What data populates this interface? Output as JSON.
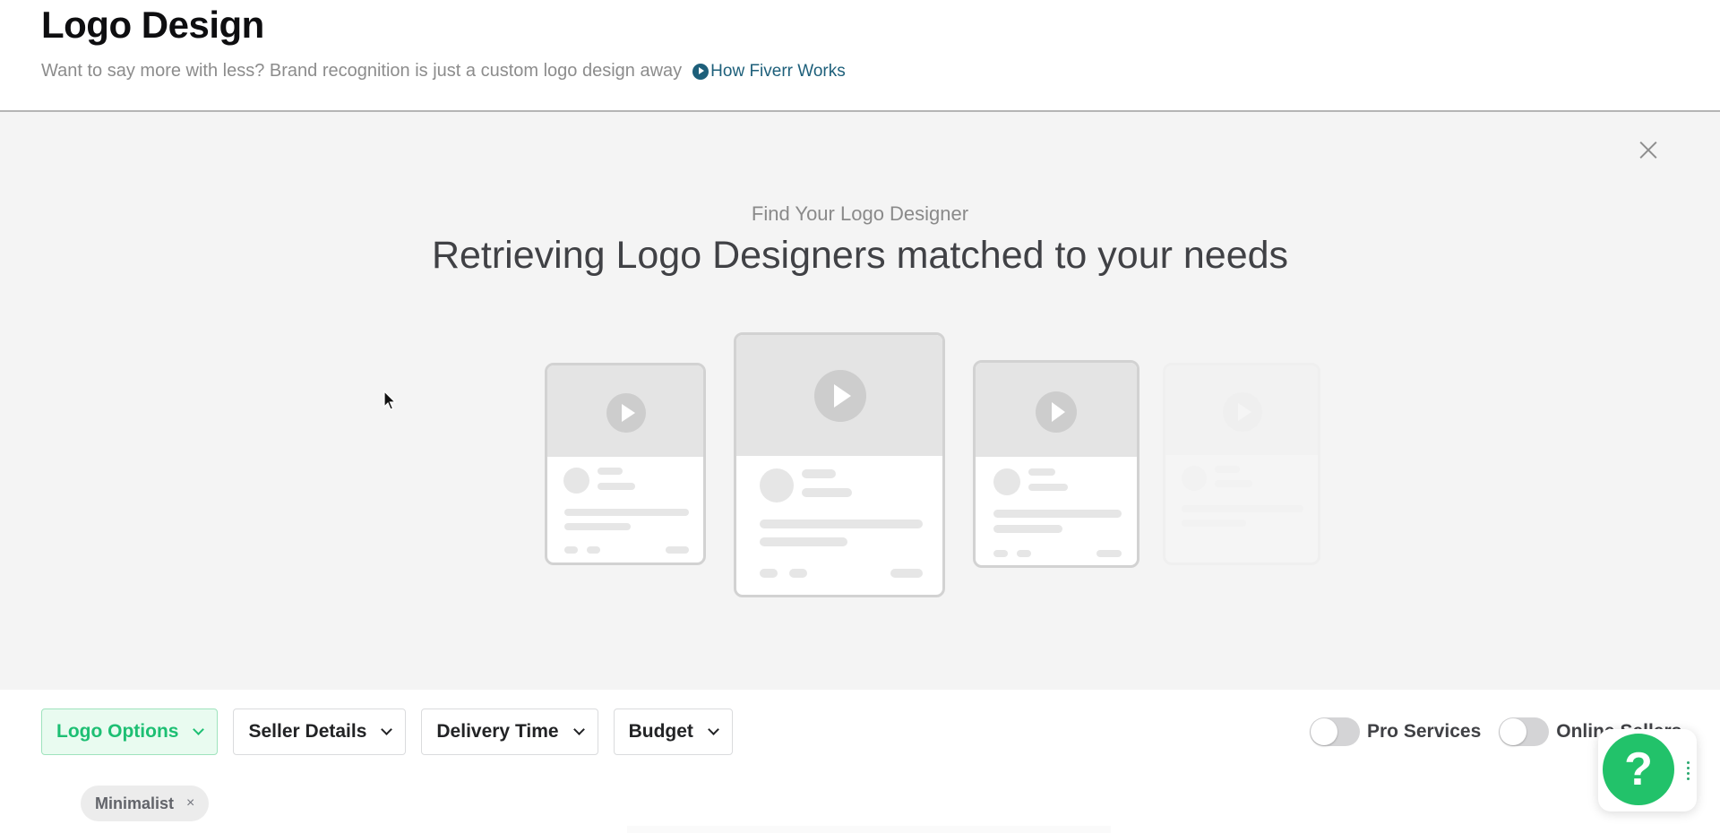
{
  "header": {
    "title": "Logo Design",
    "subtitle": "Want to say more with less? Brand recognition is just a custom logo design away",
    "how_link": {
      "label": "How Fiverr Works",
      "icon": "play-circle-icon"
    }
  },
  "loading_panel": {
    "close_icon": "close-icon",
    "eyebrow": "Find Your Logo Designer",
    "headline": "Retrieving Logo Designers matched to your needs",
    "placeholder_cards": 4
  },
  "filters": {
    "items": [
      {
        "label": "Logo Options",
        "active": true
      },
      {
        "label": "Seller Details",
        "active": false
      },
      {
        "label": "Delivery Time",
        "active": false
      },
      {
        "label": "Budget",
        "active": false
      }
    ],
    "toggles": [
      {
        "label": "Pro Services",
        "on": false
      },
      {
        "label": "Online Sellers",
        "on": false
      }
    ],
    "applied_tags": [
      {
        "label": "Minimalist",
        "remove_label": "×"
      }
    ]
  },
  "help_widget": {
    "label": "?",
    "icon": "help-icon"
  },
  "colors": {
    "accent_green": "#1dbf73",
    "link_teal": "#1d5f7a",
    "help_green": "#22c26a",
    "panel_bg": "#f4f4f4"
  }
}
